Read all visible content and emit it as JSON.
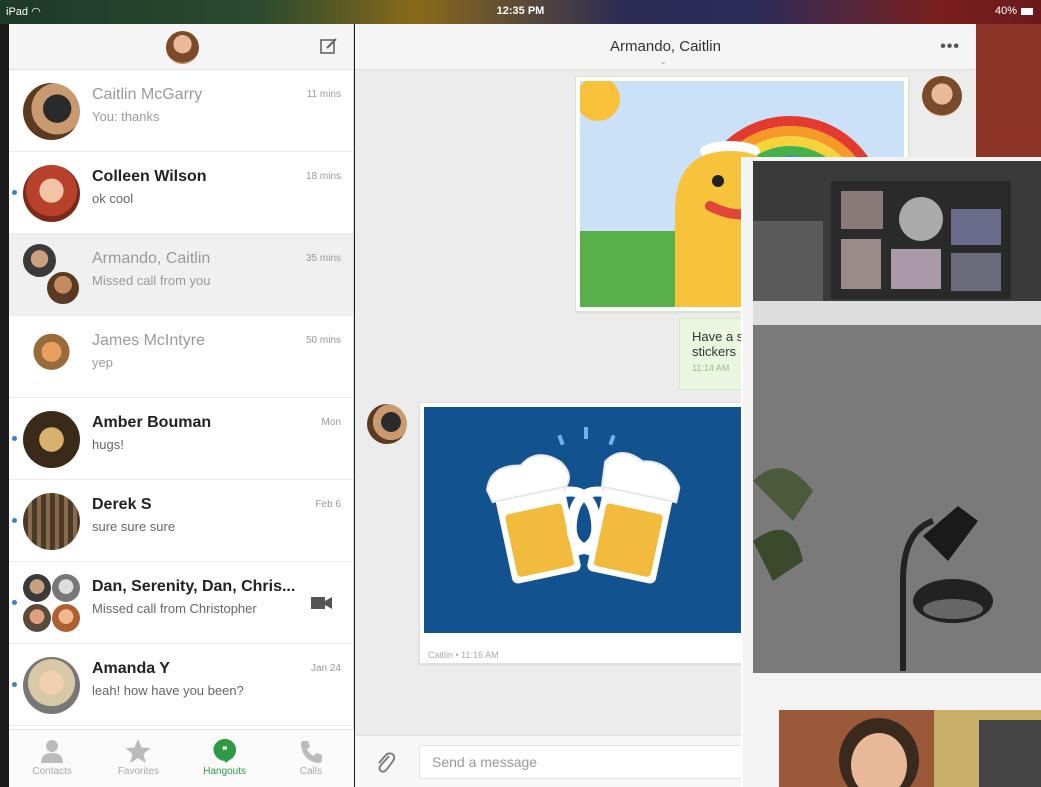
{
  "status_bar": {
    "device": "iPad",
    "time": "12:35 PM",
    "battery": "40%"
  },
  "sidebar": {
    "conversations": [
      {
        "name": "Caitlin McGarry",
        "snippet": "You: thanks",
        "time": "11 mins",
        "unread": false
      },
      {
        "name": "Colleen Wilson",
        "snippet": "ok cool",
        "time": "18 mins",
        "unread": true
      },
      {
        "name": "Armando, Caitlin",
        "snippet": "Missed call from you",
        "time": "35 mins",
        "unread": false,
        "selected": true
      },
      {
        "name": "James McIntyre",
        "snippet": "yep",
        "time": "50 mins",
        "unread": false
      },
      {
        "name": "Amber Bouman",
        "snippet": "hugs!",
        "time": "Mon",
        "unread": true
      },
      {
        "name": "Derek S",
        "snippet": "sure sure sure",
        "time": "Feb 6",
        "unread": true
      },
      {
        "name": "Dan, Serenity, Dan, Chris...",
        "snippet": "Missed call from Christopher",
        "time": "",
        "unread": true
      },
      {
        "name": "Amanda Y",
        "snippet": "leah! how have you been?",
        "time": "Jan 24",
        "unread": true
      }
    ],
    "nav": [
      {
        "label": "Contacts",
        "icon": "person-icon"
      },
      {
        "label": "Favorites",
        "icon": "star-icon"
      },
      {
        "label": "Hangouts",
        "icon": "hangouts-icon",
        "active": true
      },
      {
        "label": "Calls",
        "icon": "phone-icon"
      }
    ]
  },
  "chat": {
    "title": "Armando, Caitlin",
    "message1": {
      "text_line1": "Have a s",
      "text_line2": "stickers",
      "time": "11:14 AM"
    },
    "sticker2_meta": "Caitlin • 11:16 AM",
    "compose_placeholder": "Send a message"
  },
  "colors": {
    "hangouts_green": "#2e9a43",
    "unread_dot": "#3b82c4",
    "bubble_green": "#eaf6e0"
  }
}
